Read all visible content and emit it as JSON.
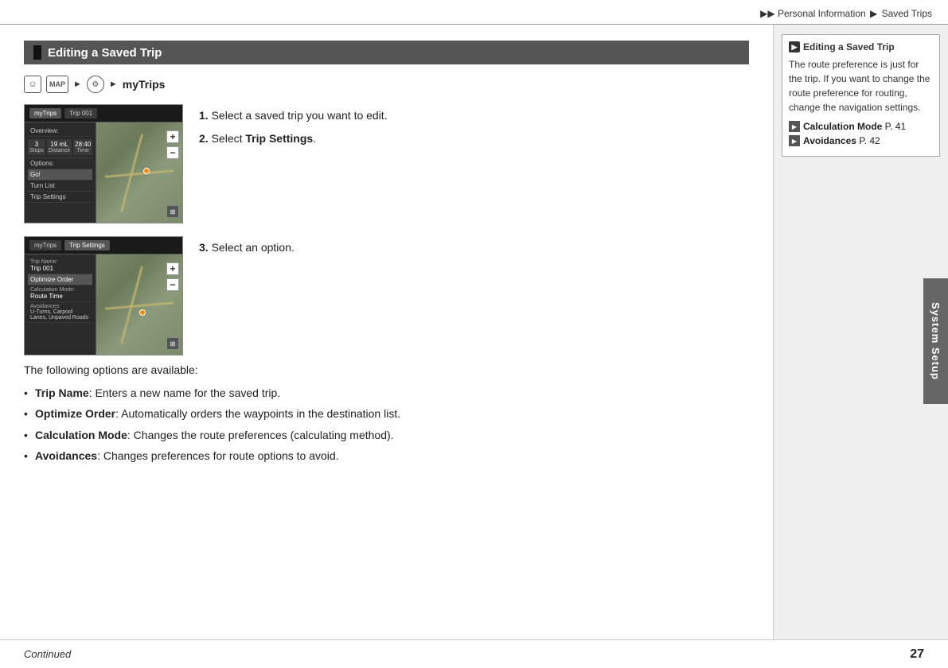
{
  "header": {
    "breadcrumb_prefix": "▶▶",
    "breadcrumb_section": "Personal Information",
    "breadcrumb_arrow": "▶",
    "breadcrumb_page": "Saved Trips"
  },
  "section": {
    "title": "Editing a Saved Trip",
    "nav_icons": [
      "person-icon",
      "map-icon"
    ],
    "nav_label": "myTrips"
  },
  "screenshot1": {
    "tab1": "myTrips",
    "tab2": "Trip 001",
    "menu_overview": "Overview:",
    "stats": [
      {
        "label": "Stops",
        "value": "3"
      },
      {
        "label": "Distance",
        "value": "19 mL"
      },
      {
        "label": "Time",
        "value": "28:40"
      }
    ],
    "menu_options": "Options:",
    "menu_go": "Go!",
    "menu_turn_list": "Turn List",
    "menu_trip_settings": "Trip Settings"
  },
  "screenshot2": {
    "tab1": "myTrips",
    "tab2": "Trip Settings",
    "menu_trip_name_label": "Trip Name:",
    "menu_trip_name_val": "Trip 001",
    "menu_optimize": "Optimize Order",
    "menu_calc_label": "Calculation Mode:",
    "menu_calc_val": "Route Time",
    "menu_avoid_label": "Avoidances:",
    "menu_avoid_val": "U-Turns, Carpool Lanes, Unpaved Roads"
  },
  "instructions": {
    "step1_num": "1.",
    "step1_text": "Select a saved trip you want to edit.",
    "step2_num": "2.",
    "step2_text_pre": "Select ",
    "step2_bold": "Trip Settings",
    "step2_text_post": ".",
    "step3_num": "3.",
    "step3_text": "Select an option."
  },
  "bullet_section": {
    "intro": "The following options are available:",
    "items": [
      {
        "bold": "Trip Name",
        "text": ": Enters a new name for the saved trip."
      },
      {
        "bold": "Optimize Order",
        "text": ": Automatically orders the waypoints in the destination list."
      },
      {
        "bold": "Calculation Mode",
        "text": ": Changes the route preferences (calculating method)."
      },
      {
        "bold": "Avoidances",
        "text": ": Changes preferences for route options to avoid."
      }
    ]
  },
  "sidebar": {
    "note_title": "Editing a Saved Trip",
    "note_icon_symbol": "▶",
    "note_text": "The route preference is just for the trip. If you want to change the route preference for routing, change the navigation settings.",
    "links": [
      {
        "icon": "▶",
        "bold": "Calculation Mode",
        "text": " P. 41"
      },
      {
        "icon": "▶",
        "bold": "Avoidances",
        "text": " P. 42"
      }
    ],
    "system_setup_label": "System Setup"
  },
  "footer": {
    "continued_label": "Continued",
    "page_number": "27"
  }
}
